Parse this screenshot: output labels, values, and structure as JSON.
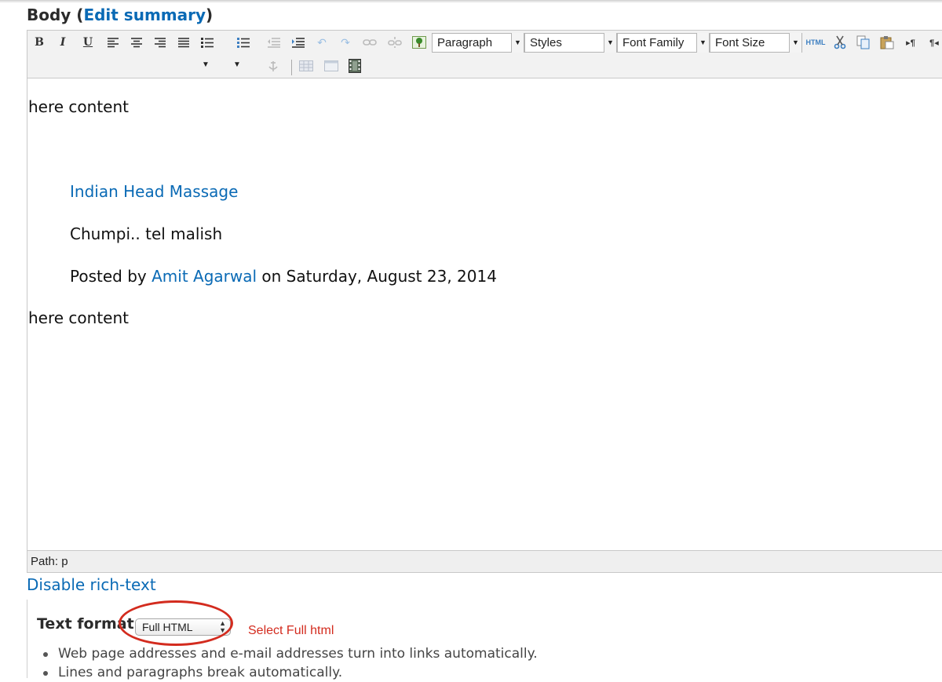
{
  "field": {
    "label": "Body",
    "open_paren": " (",
    "edit_summary_link": "Edit summary",
    "close_paren": ")"
  },
  "toolbar": {
    "format_select": "Paragraph",
    "styles_select": "Styles",
    "font_family_select": "Font Family",
    "font_size_select": "Font Size",
    "html_button": "HTML"
  },
  "content": {
    "line1": "here content",
    "post_title": "Indian Head Massage",
    "post_body": "Chumpi.. tel malish",
    "posted_by_prefix": "Posted by ",
    "author": "Amit Agarwal",
    "posted_on": " on Saturday, August 23, 2014",
    "line2": "here content"
  },
  "path_bar": "Path: p",
  "disable_link": "Disable rich-text",
  "text_format": {
    "label": "Text format",
    "selected": "Full HTML",
    "annotation": "Select Full html",
    "annotation_color": "#d32b1e",
    "tips": [
      "Web page addresses and e-mail addresses turn into links automatically.",
      "Lines and paragraphs break automatically."
    ]
  },
  "colors": {
    "link": "#0a6ab5",
    "toolbar_bg": "#f2f2f2"
  }
}
